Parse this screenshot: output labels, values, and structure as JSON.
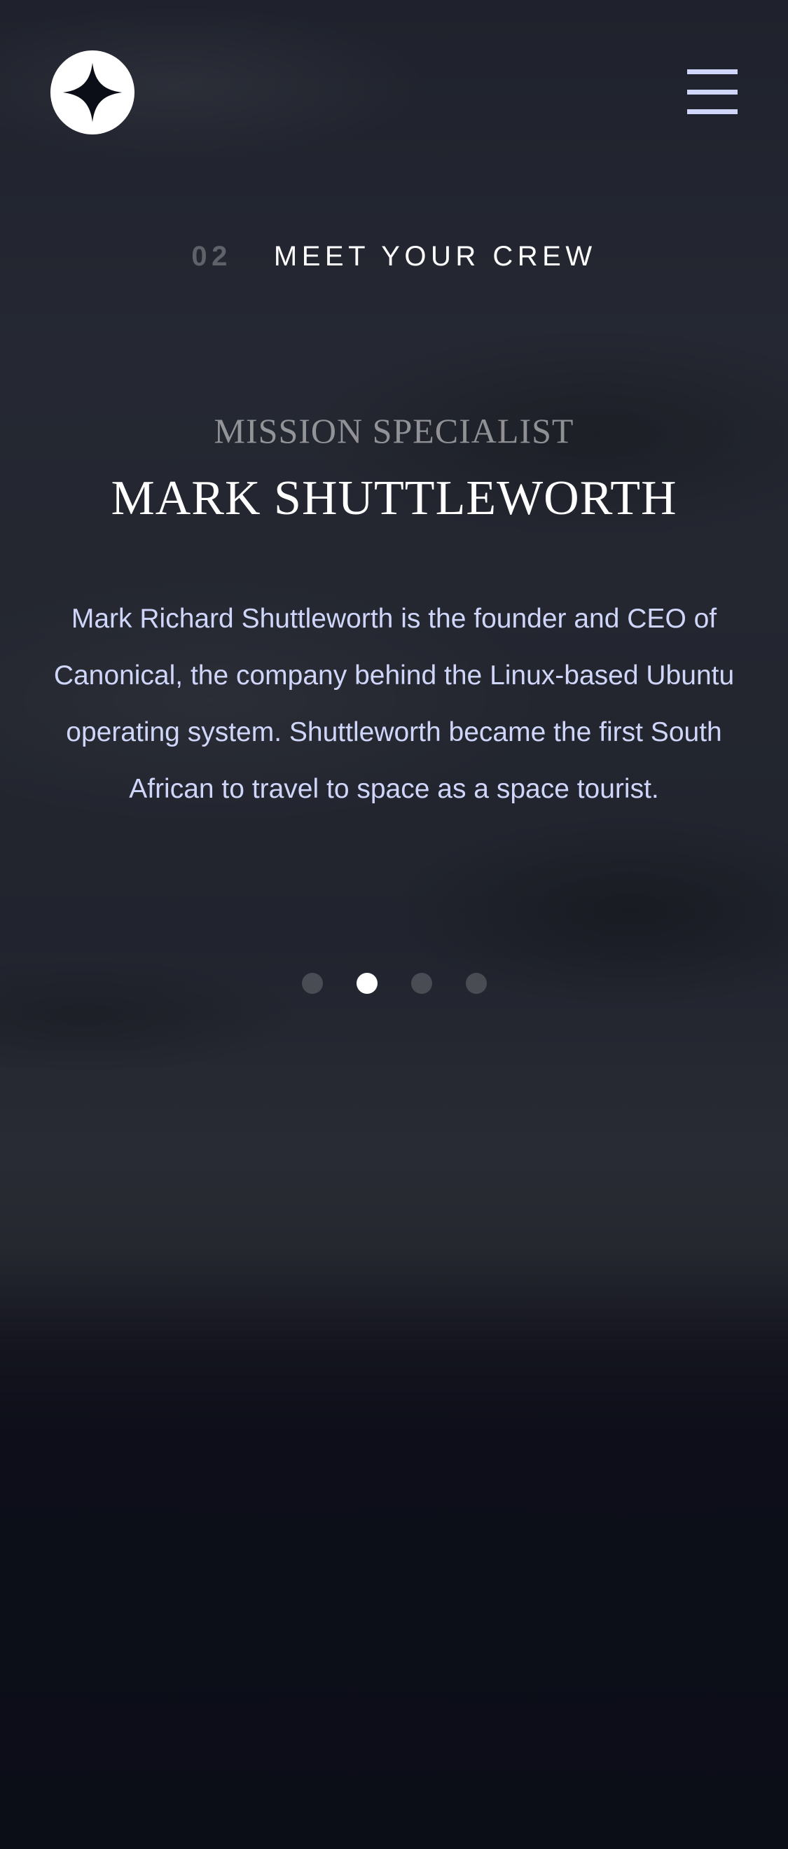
{
  "header": {
    "logo_icon": "star-logo-icon",
    "menu_icon": "hamburger-menu-icon"
  },
  "section": {
    "number": "02",
    "title": "MEET YOUR CREW"
  },
  "crew": {
    "role": "MISSION SPECIALIST",
    "name": "MARK SHUTTLEWORTH",
    "bio": "Mark Richard Shuttleworth is the founder and CEO of Canonical, the company behind the Linux-based Ubuntu operating system. Shuttleworth became the first South African to travel to space as a space tourist."
  },
  "pagination": {
    "total": 4,
    "active_index": 1
  },
  "colors": {
    "background": "#0b0d17",
    "text_light": "#d0d6f9",
    "white": "#ffffff",
    "menu_icon": "#d0d6f9"
  }
}
